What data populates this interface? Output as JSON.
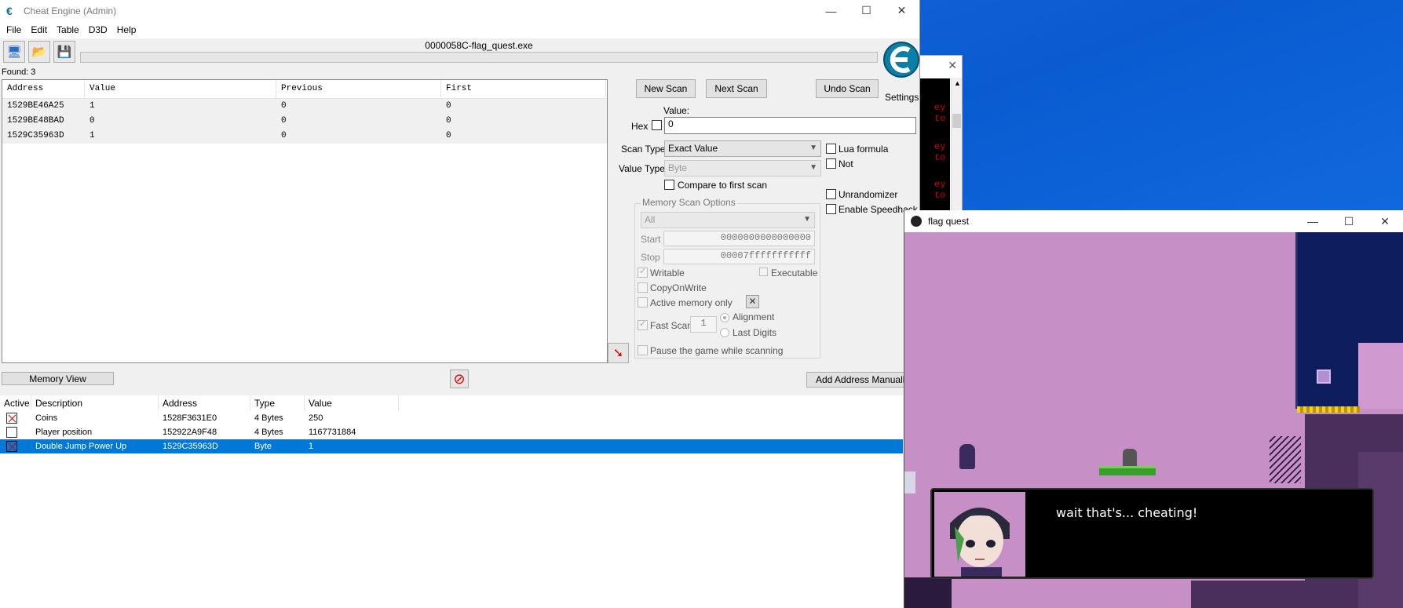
{
  "window": {
    "title": "Cheat Engine (Admin)",
    "process": "0000058C-flag_quest.exe",
    "settings_label": "Settings"
  },
  "menu": [
    "File",
    "Edit",
    "Table",
    "D3D",
    "Help"
  ],
  "window_controls": {
    "minimize": "—",
    "maximize": "☐",
    "close": "✕"
  },
  "found": "Found: 3",
  "scan_list": {
    "headers": [
      "Address",
      "Value",
      "Previous",
      "First"
    ],
    "rows": [
      [
        "1529BE46A25",
        "1",
        "0",
        "0"
      ],
      [
        "1529BE48BAD",
        "0",
        "0",
        "0"
      ],
      [
        "1529C35963D",
        "1",
        "0",
        "0"
      ]
    ]
  },
  "scan": {
    "new_scan": "New Scan",
    "next_scan": "Next Scan",
    "undo_scan": "Undo Scan",
    "value_label": "Value:",
    "hex_label": "Hex",
    "value": "0",
    "scan_type_label": "Scan Type",
    "scan_type": "Exact Value",
    "value_type_label": "Value Type",
    "value_type": "Byte",
    "compare_first": "Compare to first scan",
    "lua_formula": "Lua formula",
    "not": "Not",
    "unrandomizer": "Unrandomizer",
    "speedhack": "Enable Speedhack"
  },
  "memory_options": {
    "title": "Memory Scan Options",
    "region": "All",
    "start_label": "Start",
    "start": "0000000000000000",
    "stop_label": "Stop",
    "stop": "00007fffffffffff",
    "writable": "Writable",
    "executable": "Executable",
    "copy_on_write": "CopyOnWrite",
    "active_memory": "Active memory only",
    "fast_scan": "Fast Scan",
    "fast_scan_value": "1",
    "alignment": "Alignment",
    "last_digits": "Last Digits",
    "pause_game": "Pause the game while scanning"
  },
  "buttons": {
    "memory_view": "Memory View",
    "add_address": "Add Address Manually"
  },
  "address_table": {
    "headers": [
      "Active",
      "Description",
      "Address",
      "Type",
      "Value"
    ],
    "rows": [
      {
        "active": "x",
        "description": "Coins",
        "address": "1528F3631E0",
        "type": "4 Bytes",
        "value": "250"
      },
      {
        "active": "",
        "description": "Player position",
        "address": "152922A9F48",
        "type": "4 Bytes",
        "value": "1167731884"
      },
      {
        "active": "x",
        "description": "Double Jump Power Up",
        "address": "1529C35963D",
        "type": "Byte",
        "value": "1"
      }
    ]
  },
  "console": {
    "lines": [
      "ey to",
      "ey to",
      "ey to"
    ]
  },
  "game": {
    "title": "flag quest",
    "dialog": "wait that's... cheating!"
  }
}
